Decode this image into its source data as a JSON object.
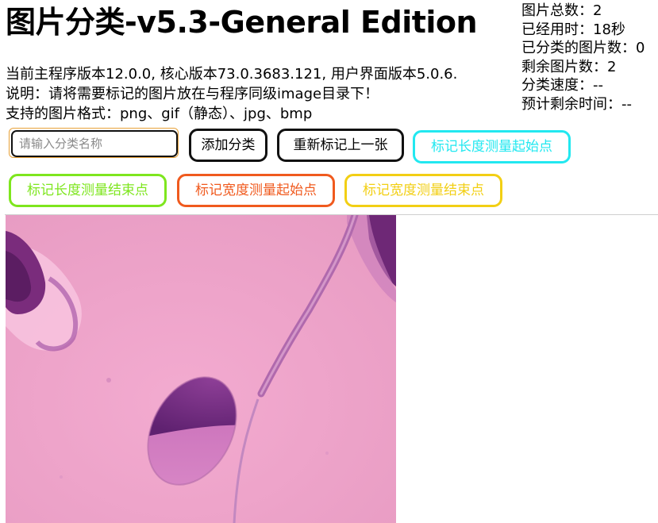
{
  "header": {
    "title": "图片分类-v5.3-General Edition"
  },
  "info": {
    "version_line": "当前主程序版本12.0.0, 核心版本73.0.3683.121, 用户界面版本5.0.6.",
    "instruction_line": "说明：请将需要标记的图片放在与程序同级image目录下！",
    "formats_line": "支持的图片格式：png、gif（静态）、jpg、bmp"
  },
  "stats": {
    "total": "图片总数：2",
    "elapsed": "已经用时：18秒",
    "classified": "已分类的图片数：0",
    "remaining": "剩余图片数：2",
    "speed": "分类速度：--",
    "eta": "预计剩余时间：--"
  },
  "controls": {
    "category_input": {
      "value": "",
      "placeholder": "请输入分类名称"
    },
    "add_category_label": "添加分类",
    "remark_previous_label": "重新标记上一张",
    "length_start_label": "标记长度测量起始点",
    "length_end_label": "标记长度测量结束点",
    "width_start_label": "标记宽度测量起始点",
    "width_end_label": "标记宽度测量结束点"
  },
  "colors": {
    "length_start": "#22e8f0",
    "length_end": "#7ee61e",
    "width_start": "#f05a1e",
    "width_end": "#f2cf14",
    "neutral": "#111111",
    "input_outline": "#e8a23a"
  }
}
